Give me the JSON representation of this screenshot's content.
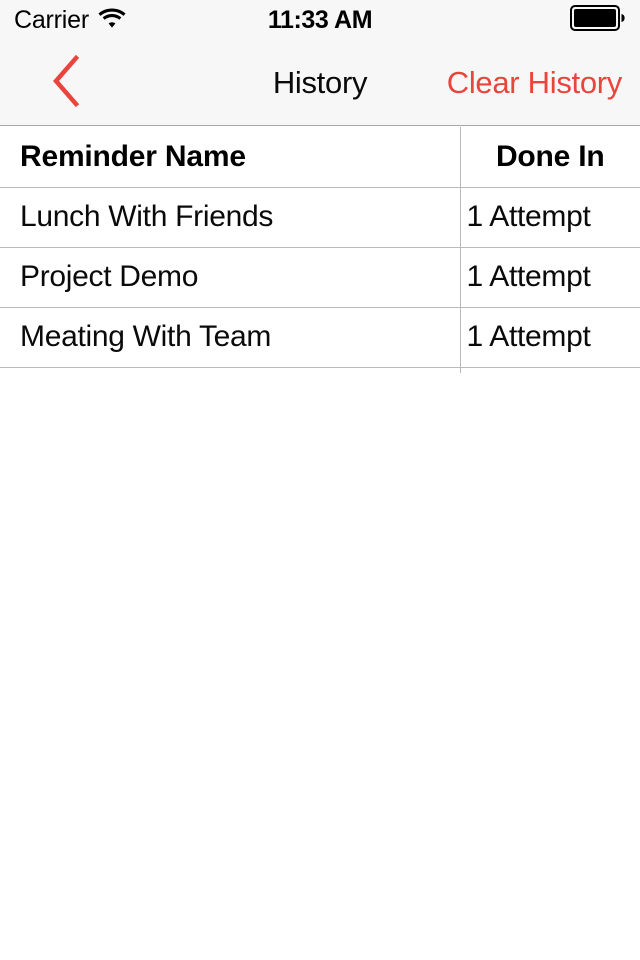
{
  "status_bar": {
    "carrier": "Carrier",
    "wifi_icon": "wifi-icon",
    "time": "11:33 AM",
    "battery_icon": "battery-full-icon"
  },
  "nav_bar": {
    "back_icon": "chevron-left-icon",
    "title": "History",
    "action_label": "Clear History",
    "accent_color": "#E8453C",
    "background_color": "#F7F7F8"
  },
  "table": {
    "columns": [
      {
        "key": "name",
        "label": "Reminder Name"
      },
      {
        "key": "done_in",
        "label": "Done In"
      }
    ],
    "rows": [
      {
        "name": "Lunch With Friends",
        "done_in": "1 Attempt"
      },
      {
        "name": "Project Demo",
        "done_in": "1 Attempt"
      },
      {
        "name": "Meating With Team",
        "done_in": "1 Attempt"
      }
    ]
  }
}
